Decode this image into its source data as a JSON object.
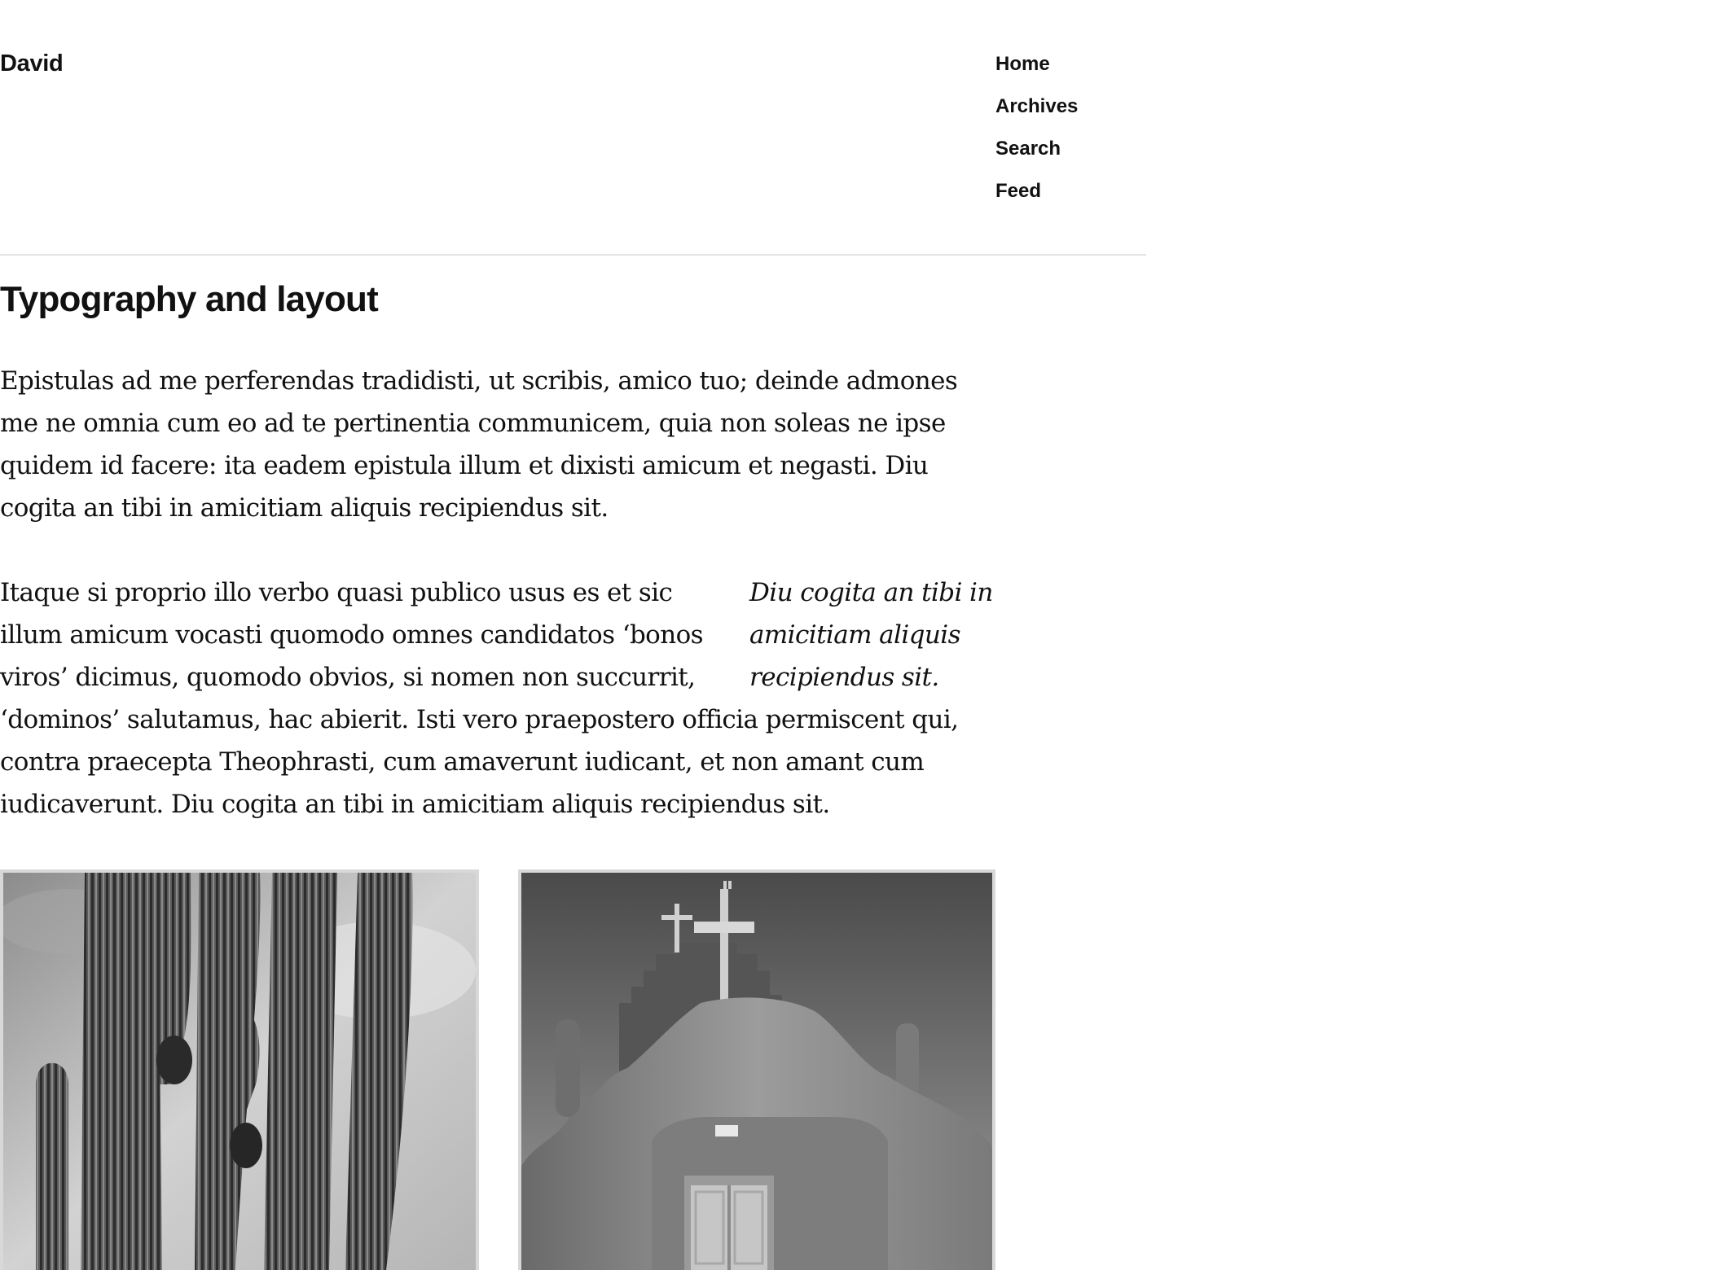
{
  "header": {
    "site_title": "David",
    "nav": [
      "Home",
      "Archives",
      "Search",
      "Feed"
    ]
  },
  "post": {
    "title": "Typography and layout",
    "paragraph1": "Epistulas ad me perferendas tradidisti, ut scribis, amico tuo; deinde admones me ne omnia cum eo ad te pertinentia communicem, quia non soleas ne ipse quidem id facere: ita eadem epistula illum et dixisti amicum et negasti. Diu cogita an tibi in amicitiam aliquis recipiendus sit.",
    "pullquote": "Diu cogita an tibi in amicitiam aliquis recipiendus sit.",
    "paragraph2": "Itaque si proprio illo verbo quasi publico usus es et sic illum amicum vocasti quomodo omnes candidatos ‘bonos viros’ dicimus, quomodo obvios, si nomen non succurrit, ‘dominos’ salutamus, hac abierit. Isti vero praepostero officia permiscent qui, contra praecepta Theophrasti, cum amaverunt iudicant, et non amant cum iudicaverunt. Diu cogita an tibi in amicitiam aliquis recipiendus sit."
  },
  "gallery": {
    "images": [
      "saguaro-cactus-photo",
      "adobe-church-photo"
    ]
  }
}
